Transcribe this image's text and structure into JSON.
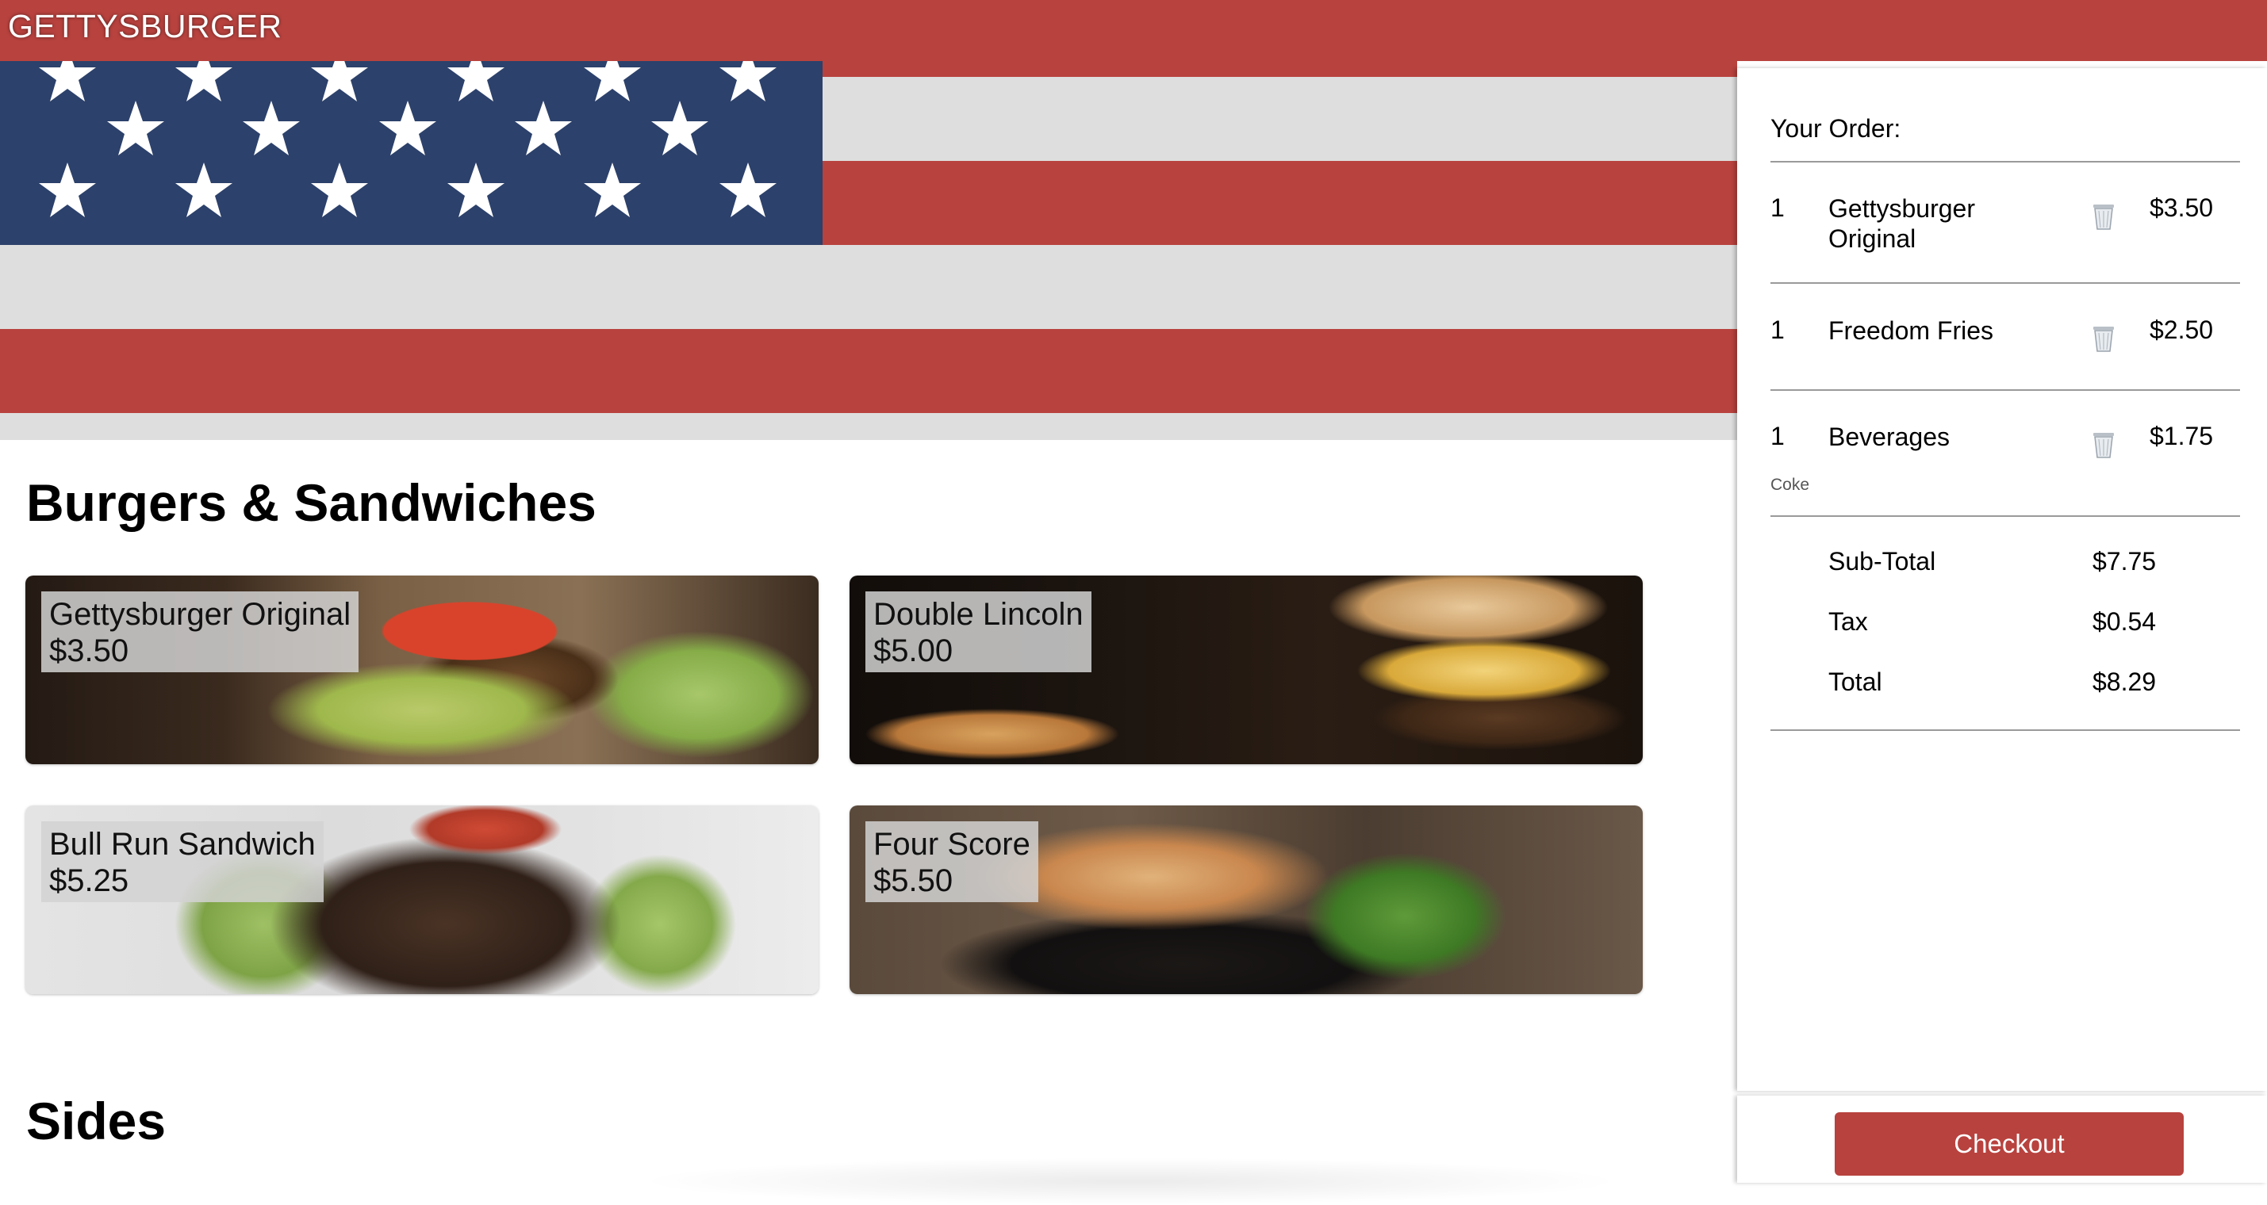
{
  "app": {
    "brand": "GETTYSBURGER"
  },
  "colors": {
    "accent": "#b8423e",
    "flag_blue": "#2c416b",
    "flag_white": "#dedede"
  },
  "menu": {
    "sections": [
      {
        "title": "Burgers & Sandwiches",
        "items": [
          {
            "name": "Gettysburger Original",
            "price": "$3.50"
          },
          {
            "name": "Double Lincoln",
            "price": "$5.00"
          },
          {
            "name": "Bull Run Sandwich",
            "price": "$5.25"
          },
          {
            "name": "Four Score",
            "price": "$5.50"
          }
        ]
      },
      {
        "title": "Sides"
      }
    ]
  },
  "order": {
    "title": "Your Order:",
    "items": [
      {
        "qty": "1",
        "name": "Gettysburger Original",
        "price": "$3.50",
        "icon": "trash-icon"
      },
      {
        "qty": "1",
        "name": "Freedom Fries",
        "price": "$2.50",
        "icon": "trash-icon"
      },
      {
        "qty": "1",
        "name": "Beverages",
        "price": "$1.75",
        "note": "Coke",
        "icon": "trash-icon"
      }
    ],
    "totals": [
      {
        "label": "Sub-Total",
        "value": "$7.75"
      },
      {
        "label": "Tax",
        "value": "$0.54"
      },
      {
        "label": "Total",
        "value": "$8.29"
      }
    ],
    "checkout_label": "Checkout"
  }
}
